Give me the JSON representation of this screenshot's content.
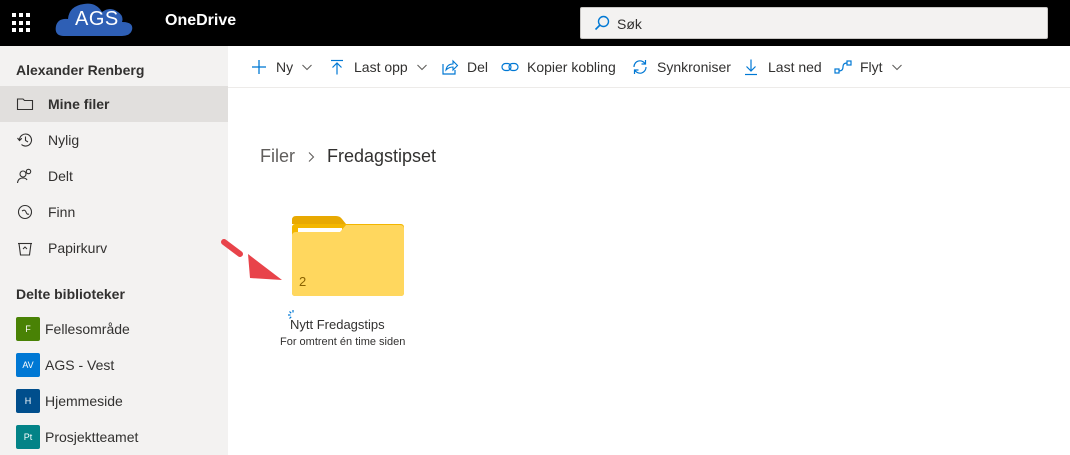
{
  "header": {
    "logo_text": "AGS",
    "app_name": "OneDrive",
    "search_placeholder": "Søk"
  },
  "sidebar": {
    "user_name": "Alexander Renberg",
    "items": [
      {
        "label": "Mine filer",
        "icon": "folder-icon",
        "selected": true
      },
      {
        "label": "Nylig",
        "icon": "history-icon",
        "selected": false
      },
      {
        "label": "Delt",
        "icon": "people-icon",
        "selected": false
      },
      {
        "label": "Finn",
        "icon": "discover-icon",
        "selected": false
      },
      {
        "label": "Papirkurv",
        "icon": "recycle-bin-icon",
        "selected": false
      }
    ],
    "shared_libraries_heading": "Delte biblioteker",
    "libraries": [
      {
        "label": "Fellesområde",
        "badge": "F",
        "color": "#498205"
      },
      {
        "label": "AGS - Vest",
        "badge": "AV",
        "color": "#0078d4"
      },
      {
        "label": "Hjemmeside",
        "badge": "H",
        "color": "#004e8c"
      },
      {
        "label": "Prosjektteamet",
        "badge": "Pt",
        "color": "#038387"
      }
    ]
  },
  "commands": [
    {
      "label": "Ny",
      "icon": "plus-icon",
      "chevron": true
    },
    {
      "label": "Last opp",
      "icon": "upload-icon",
      "chevron": true
    },
    {
      "label": "Del",
      "icon": "share-icon",
      "chevron": false
    },
    {
      "label": "Kopier kobling",
      "icon": "link-icon",
      "chevron": false
    },
    {
      "label": "Synkroniser",
      "icon": "sync-icon",
      "chevron": false
    },
    {
      "label": "Last ned",
      "icon": "download-icon",
      "chevron": false
    },
    {
      "label": "Flyt",
      "icon": "flow-icon",
      "chevron": true
    }
  ],
  "breadcrumb": {
    "root": "Filer",
    "current": "Fredagstipset"
  },
  "tile": {
    "item_count": "2",
    "name": "Nytt Fredagstips",
    "modified": "For omtrent én time siden"
  },
  "colors": {
    "topbar": "#000000",
    "sidebar": "#f3f2f1",
    "selected": "#e1dfdd",
    "accent": "#0078d4",
    "folder": "#ffd75e",
    "arrow": "#e8434a"
  }
}
